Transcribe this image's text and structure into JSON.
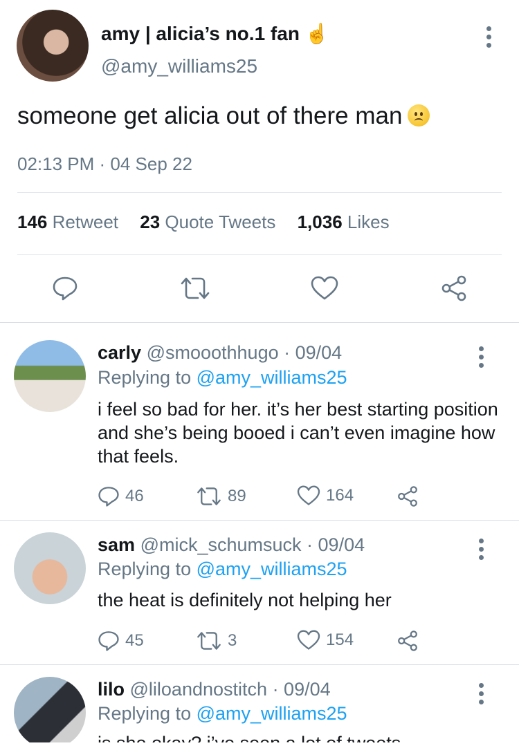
{
  "main_tweet": {
    "display_name": "amy | alicia’s no.1 fan ☝️",
    "handle": "@amy_williams25",
    "text": "someone get alicia out of there man",
    "timestamp": "02:13 PM · 04 Sep 22",
    "stats": [
      {
        "count": "146",
        "label": "Retweet"
      },
      {
        "count": "23",
        "label": "Quote Tweets"
      },
      {
        "count": "1,036",
        "label": "Likes"
      }
    ],
    "actions": [
      "reply-icon",
      "retweet-icon",
      "like-icon",
      "share-icon"
    ]
  },
  "replies": [
    {
      "name": "carly",
      "handle": "@smooothhugo",
      "date": "· 09/04",
      "replying_prefix": "Replying to",
      "replying_to": "@amy_williams25",
      "text": "i feel so bad for her. it’s her best starting position and she’s being booed i can’t even imagine how that feels.",
      "replies": "46",
      "retweets": "89",
      "likes": "164"
    },
    {
      "name": "sam",
      "handle": "@mick_schumsuck",
      "date": "· 09/04",
      "replying_prefix": "Replying to",
      "replying_to": "@amy_williams25",
      "text": "the heat is definitely not helping her",
      "replies": "45",
      "retweets": "3",
      "likes": "154"
    },
    {
      "name": "lilo",
      "handle": "@liloandnostitch",
      "date": "· 09/04",
      "replying_prefix": "Replying to",
      "replying_to": "@amy_williams25",
      "text": "is she okay? i’ve seen a lot of tweets"
    }
  ],
  "colors": {
    "text": "#14171a",
    "secondary": "#657786",
    "link": "#1da1f2",
    "divider": "#e1e8ed"
  }
}
